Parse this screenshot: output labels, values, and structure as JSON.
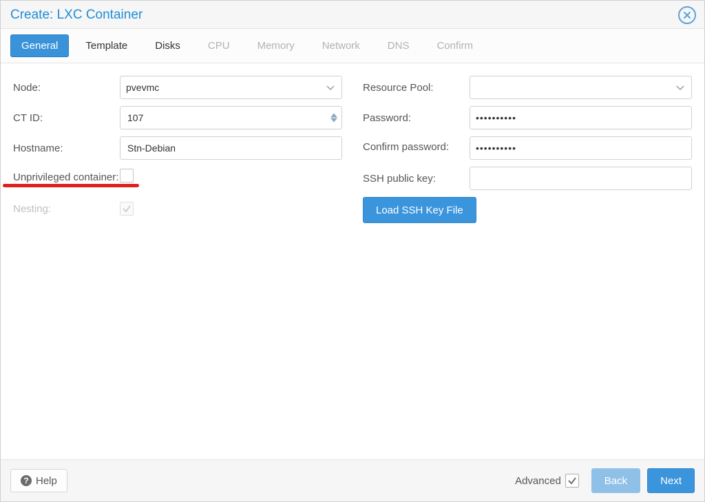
{
  "dialog": {
    "title": "Create: LXC Container"
  },
  "tabs": {
    "general": "General",
    "template": "Template",
    "disks": "Disks",
    "cpu": "CPU",
    "memory": "Memory",
    "network": "Network",
    "dns": "DNS",
    "confirm": "Confirm"
  },
  "left": {
    "node_label": "Node:",
    "node_value": "pvevmc",
    "ctid_label": "CT ID:",
    "ctid_value": "107",
    "hostname_label": "Hostname:",
    "hostname_value": "Stn-Debian",
    "unpriv_label": "Unprivileged container:",
    "nesting_label": "Nesting:"
  },
  "right": {
    "pool_label": "Resource Pool:",
    "pool_value": "",
    "password_label": "Password:",
    "password_value": "••••••••••",
    "confirm_label": "Confirm password:",
    "confirm_value": "••••••••••",
    "sshkey_label": "SSH public key:",
    "sshkey_value": "",
    "load_ssh_button": "Load SSH Key File"
  },
  "footer": {
    "help": "Help",
    "advanced": "Advanced",
    "back": "Back",
    "next": "Next"
  }
}
